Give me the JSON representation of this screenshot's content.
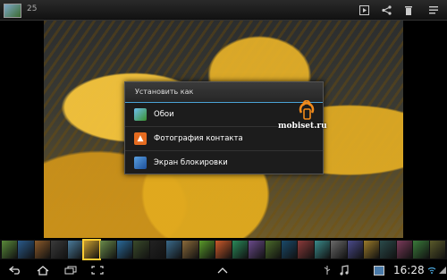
{
  "topbar": {
    "album_count": "25",
    "icons": [
      "app-thumbnail-icon",
      "slideshow-icon",
      "share-icon",
      "delete-icon",
      "menu-icon"
    ]
  },
  "dialog": {
    "title": "Установить как",
    "options": [
      {
        "label": "Обои",
        "icon": "wallpaper-icon"
      },
      {
        "label": "Фотография контакта",
        "icon": "contact-photo-icon"
      },
      {
        "label": "Экран блокировки",
        "icon": "lock-screen-icon"
      }
    ]
  },
  "watermark": "mobiset.ru",
  "filmstrip": {
    "thumb_colors": [
      "#5a8a3a",
      "#2a5a8a",
      "#8a5a2a",
      "#3a3a3a",
      "#4a7a9a",
      "#cca030",
      "#6a8a4a",
      "#2a6a9a",
      "#3a4a2a",
      "#222222",
      "#3a6a8a",
      "#8a6a3a",
      "#5a9a2a",
      "#cc5a2a",
      "#2a8a5a",
      "#6a4a8a",
      "#4a6a2a",
      "#1a4a6a",
      "#8a3a3a",
      "#3a8a8a",
      "#6a6a6a",
      "#4a4a8a",
      "#9a7a2a",
      "#2a4a4a",
      "#7a3a5a",
      "#3a7a3a",
      "#5a5a2a"
    ],
    "selected_index": 5
  },
  "navbar": {
    "time": "16:28",
    "icons": [
      "back-icon",
      "home-icon",
      "recent-apps-icon",
      "screenshot-icon",
      "up-arrow-icon",
      "usb-icon",
      "music-icon",
      "gallery-notification-icon",
      "wifi-icon",
      "signal-icon"
    ]
  }
}
